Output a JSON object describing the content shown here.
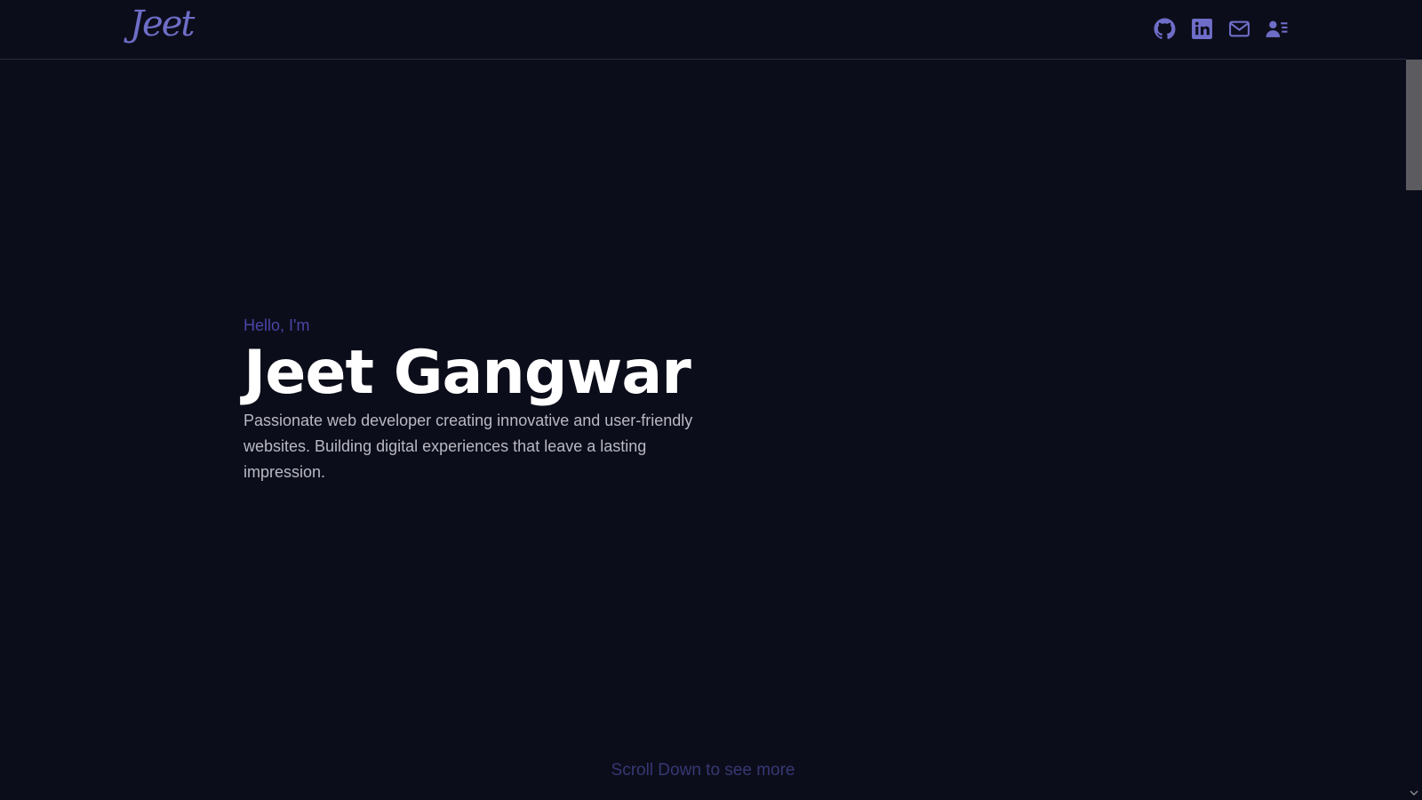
{
  "navbar": {
    "logo_text": "Jeet",
    "icons": [
      "github-icon",
      "linkedin-icon",
      "mail-icon",
      "resume-icon"
    ]
  },
  "hero": {
    "greeting": "Hello, I'm",
    "name": "Jeet Gangwar",
    "tagline": "Passionate web developer creating innovative and user-friendly websites. Building digital experiences that leave a lasting impression."
  },
  "footer": {
    "scroll_hint": "Scroll Down to see more"
  },
  "colors": {
    "background": "#0c0d1a",
    "accent": "#6e6dc8",
    "greeting": "#4a46a8",
    "name": "#ffffff",
    "tagline": "#b9b9c4",
    "scroll_hint": "#353873"
  }
}
